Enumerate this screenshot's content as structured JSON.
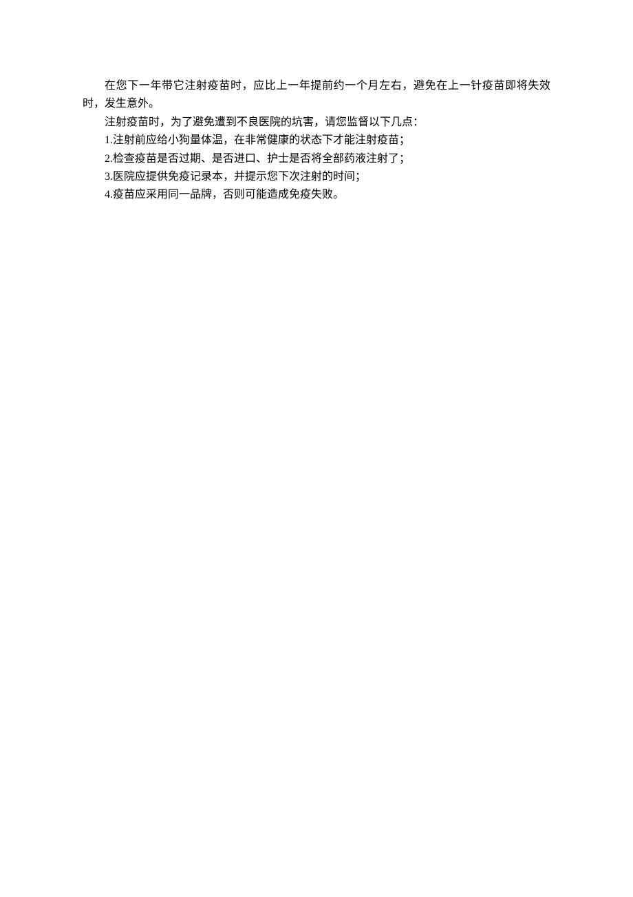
{
  "document": {
    "paragraph1": "在您下一年带它注射疫苗时，应比上一年提前约一个月左右，避免在上一针疫苗即将失效时，发生意外。",
    "paragraph2": "注射疫苗时，为了避免遭到不良医院的坑害，请您监督以下几点：",
    "items": [
      "1.注射前应给小狗量体温，在非常健康的状态下才能注射疫苗；",
      "2.检查疫苗是否过期、是否进口、护士是否将全部药液注射了；",
      "3.医院应提供免疫记录本，并提示您下次注射的时间；",
      "4.疫苗应采用同一品牌，否则可能造成免疫失败。"
    ]
  }
}
